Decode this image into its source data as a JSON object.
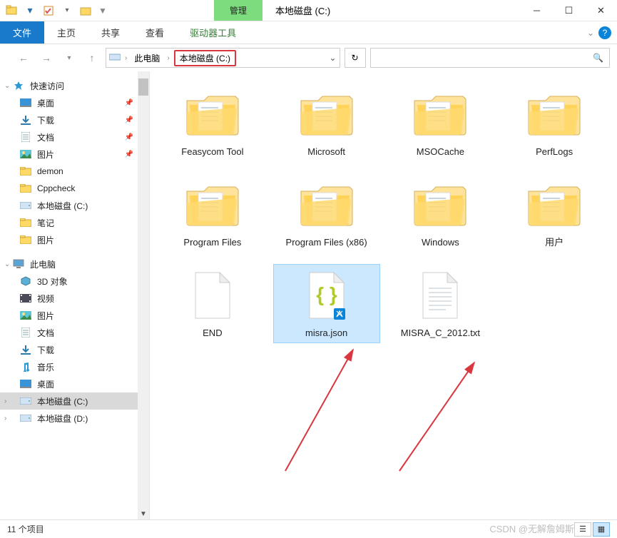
{
  "title_bar": {
    "manage": "管理",
    "title": "本地磁盘 (C:)"
  },
  "ribbon": {
    "file": "文件",
    "home": "主页",
    "share": "共享",
    "view": "查看",
    "drive_tools": "驱动器工具"
  },
  "address": {
    "this_pc": "此电脑",
    "drive": "本地磁盘 (C:)"
  },
  "search": {
    "placeholder": ""
  },
  "sidebar": {
    "quick_access": "快速访问",
    "qa_items": [
      {
        "label": "桌面",
        "pin": true,
        "icon": "desktop"
      },
      {
        "label": "下载",
        "pin": true,
        "icon": "download"
      },
      {
        "label": "文档",
        "pin": true,
        "icon": "document"
      },
      {
        "label": "图片",
        "pin": true,
        "icon": "picture"
      },
      {
        "label": "demon",
        "pin": false,
        "icon": "folder"
      },
      {
        "label": "Cppcheck",
        "pin": false,
        "icon": "folder"
      },
      {
        "label": "本地磁盘 (C:)",
        "pin": false,
        "icon": "drive"
      },
      {
        "label": "笔记",
        "pin": false,
        "icon": "folder"
      },
      {
        "label": "图片",
        "pin": false,
        "icon": "folder"
      }
    ],
    "this_pc": "此电脑",
    "pc_items": [
      {
        "label": "3D 对象",
        "icon": "3d"
      },
      {
        "label": "视频",
        "icon": "video"
      },
      {
        "label": "图片",
        "icon": "picture"
      },
      {
        "label": "文档",
        "icon": "document"
      },
      {
        "label": "下载",
        "icon": "download"
      },
      {
        "label": "音乐",
        "icon": "music"
      },
      {
        "label": "桌面",
        "icon": "desktop"
      },
      {
        "label": "本地磁盘 (C:)",
        "icon": "drive",
        "selected": true
      },
      {
        "label": "本地磁盘 (D:)",
        "icon": "drive"
      }
    ]
  },
  "files": [
    {
      "label": "Feasycom Tool",
      "type": "folder"
    },
    {
      "label": "Microsoft",
      "type": "folder"
    },
    {
      "label": "MSOCache",
      "type": "folder"
    },
    {
      "label": "PerfLogs",
      "type": "folder"
    },
    {
      "label": "Program Files",
      "type": "folder"
    },
    {
      "label": "Program Files (x86)",
      "type": "folder"
    },
    {
      "label": "Windows",
      "type": "folder"
    },
    {
      "label": "用户",
      "type": "folder"
    },
    {
      "label": "END",
      "type": "file-blank"
    },
    {
      "label": "misra.json",
      "type": "file-json",
      "selected": true
    },
    {
      "label": "MISRA_C_2012.txt",
      "type": "file-text"
    }
  ],
  "status": {
    "count": "11 个项目"
  },
  "watermark": "CSDN @无解詹姆斯"
}
